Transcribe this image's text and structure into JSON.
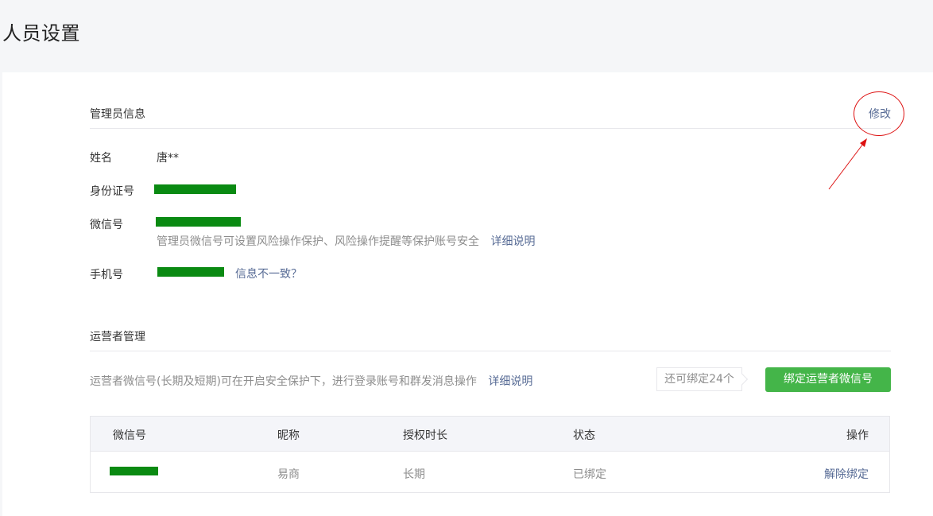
{
  "page": {
    "title": "人员设置"
  },
  "admin": {
    "section_title": "管理员信息",
    "edit_label": "修改",
    "fields": {
      "name_label": "姓名",
      "name_value": "唐**",
      "id_label": "身份证号",
      "wechat_label": "微信号",
      "wechat_hint": "管理员微信号可设置风险操作保护、风险操作提醒等保护账号安全",
      "wechat_detail_link": "详细说明",
      "phone_label": "手机号",
      "phone_mismatch_link": "信息不一致？"
    }
  },
  "operators": {
    "section_title": "运营者管理",
    "description": "运营者微信号(长期及短期)可在开启安全保护下，进行登录账号和群发消息操作",
    "detail_link": "详细说明",
    "quota_text": "还可绑定24个",
    "bind_button": "绑定运营者微信号",
    "table": {
      "headers": [
        "微信号",
        "昵称",
        "授权时长",
        "状态",
        "操作"
      ],
      "rows": [
        {
          "nickname": "易商",
          "duration": "长期",
          "status": "已绑定",
          "action": "解除绑定"
        }
      ]
    }
  },
  "colors": {
    "accent_green": "#44b549",
    "link_blue": "#576b95",
    "annotation_red": "#dd1111",
    "redaction_green": "#0a8a12"
  }
}
